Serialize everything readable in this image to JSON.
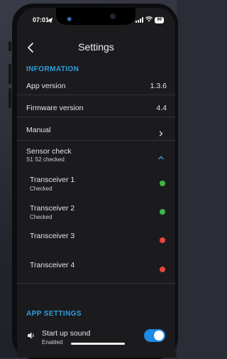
{
  "status_bar": {
    "time": "07:01",
    "battery": "99",
    "icons": [
      "location-arrow-icon",
      "bluetooth-icon",
      "signal-icon",
      "wifi-icon",
      "battery-icon"
    ]
  },
  "header": {
    "title": "Settings",
    "back_icon": "chevron-left-icon"
  },
  "information": {
    "section_title": "INFORMATION",
    "app_version": {
      "label": "App version",
      "value": "1.3.6"
    },
    "firmware_version": {
      "label": "Firmware version",
      "value": "4.4"
    },
    "manual": {
      "label": "Manual"
    },
    "sensor_check": {
      "label": "Sensor check",
      "subtitle": "S1 S2 checked",
      "expanded": true
    },
    "transceivers": [
      {
        "label": "Transceiver 1",
        "status": "Checked",
        "ok": true
      },
      {
        "label": "Transceiver 2",
        "status": "Checked",
        "ok": true
      },
      {
        "label": "Transceiver 3",
        "status": "",
        "ok": false
      },
      {
        "label": "Transceiver 4",
        "status": "",
        "ok": false
      }
    ]
  },
  "app_settings": {
    "section_title": "APP SETTINGS",
    "startup_sound": {
      "label": "Start up sound",
      "status": "Enabled",
      "enabled": true
    }
  },
  "colors": {
    "accent": "#2f9fe2",
    "ok": "#3fb64b",
    "error": "#e8453c",
    "toggle_on": "#1e8ae6",
    "background": "#1b1b1e"
  }
}
